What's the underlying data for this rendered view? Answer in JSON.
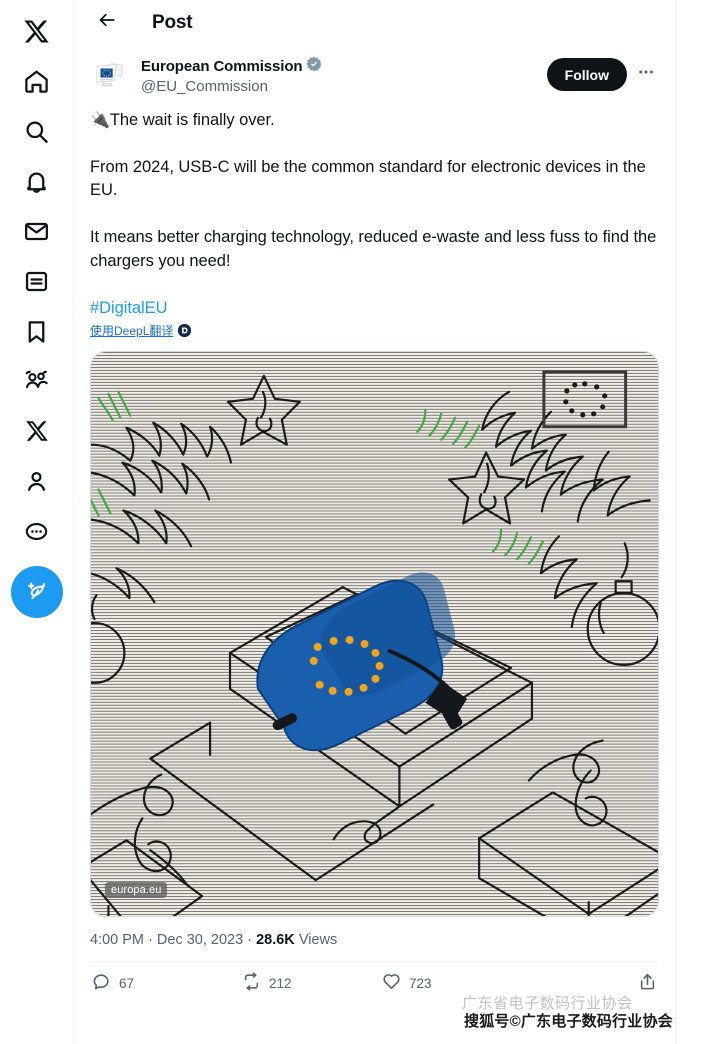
{
  "sidebar": {
    "items": [
      {
        "name": "x-logo-icon",
        "label": "X"
      },
      {
        "name": "home-icon",
        "label": "Home"
      },
      {
        "name": "search-icon",
        "label": "Explore"
      },
      {
        "name": "bell-icon",
        "label": "Notifications"
      },
      {
        "name": "mail-icon",
        "label": "Messages"
      },
      {
        "name": "list-icon",
        "label": "Lists"
      },
      {
        "name": "bookmark-icon",
        "label": "Bookmarks"
      },
      {
        "name": "communities-icon",
        "label": "Communities"
      },
      {
        "name": "premium-x-icon",
        "label": "Premium"
      },
      {
        "name": "profile-icon",
        "label": "Profile"
      },
      {
        "name": "more-dots-icon",
        "label": "More"
      }
    ],
    "compose_icon": "compose-feather-icon",
    "compose_label": "Post"
  },
  "header": {
    "back_icon": "back-arrow-icon",
    "title": "Post"
  },
  "author": {
    "avatar_name": "european-commission-avatar",
    "display_name": "European Commission",
    "verified_icon": "verified-gray-badge-icon",
    "handle": "@EU_Commission",
    "follow_label": "Follow",
    "more_icon": "more-dots-icon"
  },
  "post": {
    "emoji": "🔌",
    "line1": "The wait is finally over.",
    "line2": "From 2024, USB-C will be the common standard for electronic devices in the EU.",
    "line3": "It means better charging technology, reduced e-waste and less fuss to find the chargers you need!",
    "hashtag": "#DigitalEU",
    "translate_label": "使用DeepL翻译",
    "translate_badge_icon": "deepl-icon"
  },
  "media": {
    "alt": "Line-art illustration of a blue USB-C charger with EU stars on an open gift box surrounded by Christmas tree branches, stars and baubles",
    "watermark_label": "europa.eu",
    "flag_label": "EU flag"
  },
  "meta": {
    "time": "4:00 PM",
    "separator": "·",
    "date": "Dec 30, 2023",
    "views_count": "28.6K",
    "views_label": "Views"
  },
  "actions": [
    {
      "name": "reply-button",
      "icon": "reply-bubble-icon",
      "count": "67"
    },
    {
      "name": "repost-button",
      "icon": "repost-arrows-icon",
      "count": "212"
    },
    {
      "name": "like-button",
      "icon": "heart-icon",
      "count": "723"
    },
    {
      "name": "share-button",
      "icon": "share-upload-icon",
      "count": ""
    }
  ],
  "watermark": {
    "top_text": "广东省电子数码行业协会",
    "bottom_text": "搜狐号©广东电子数码行业协会"
  },
  "colors": {
    "accent": "#1d9bf0",
    "text": "#0f1419",
    "muted": "#536471",
    "border": "#eff3f4",
    "eu_blue": "#0b4ea2",
    "eu_gold": "#f5a623"
  }
}
